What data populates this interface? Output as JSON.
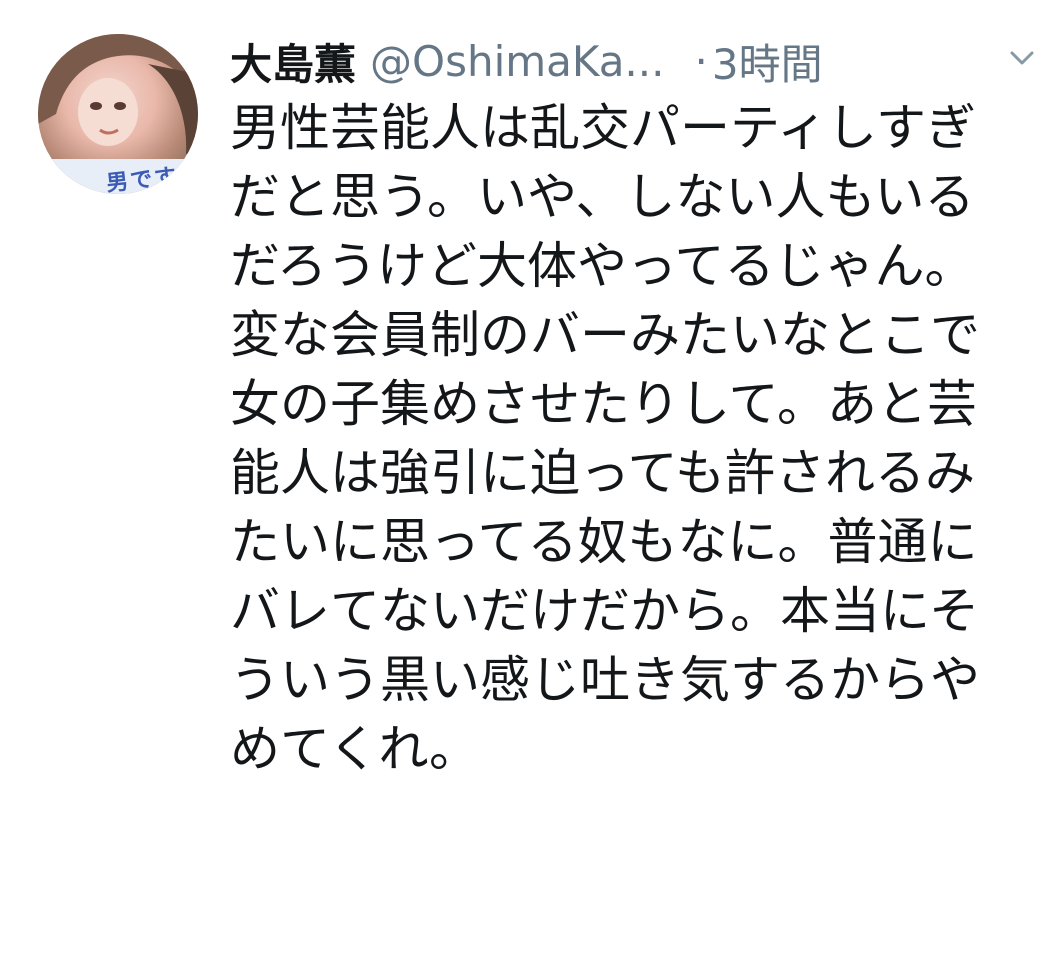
{
  "header": {
    "display_name": "大島薫",
    "handle": "@OshimaKa...",
    "separator": "·",
    "time": "3時間"
  },
  "avatar": {
    "caption": "男です"
  },
  "tweet": {
    "text": "男性芸能人は乱交パーティしすぎだと思う。いや、しない人もいるだろうけど大体やってるじゃん。変な会員制のバーみたいなとこで女の子集めさせたりして。あと芸能人は強引に迫っても許されるみたいに思ってる奴もなに。普通にバレてないだけだから。本当にそういう黒い感じ吐き気するからやめてくれ。"
  },
  "colors": {
    "text": "#14171a",
    "secondary": "#657786",
    "background": "#ffffff"
  },
  "icons": {
    "menu": "chevron-down-icon"
  }
}
